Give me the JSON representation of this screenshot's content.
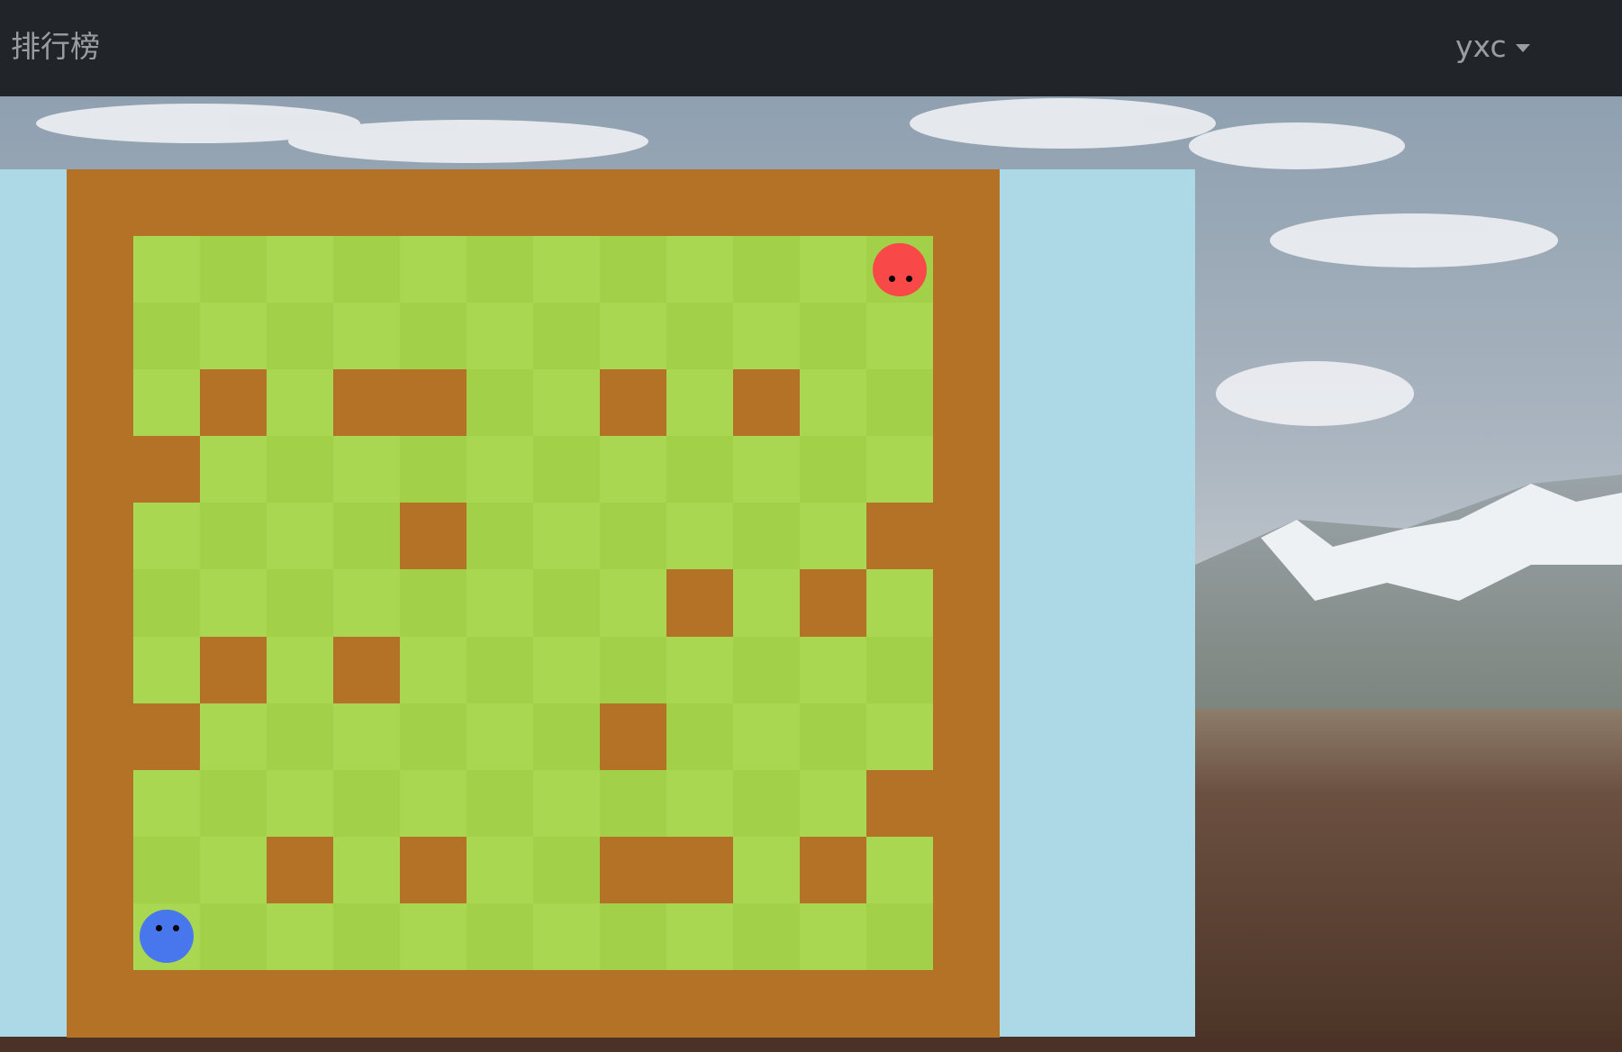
{
  "navbar": {
    "brand": "排行榜",
    "user_menu_label": "yxc"
  },
  "game": {
    "rows": 13,
    "cols": 14,
    "colors": {
      "wall": "#b37226",
      "grass_light": "#aad751",
      "grass_dark": "#a2d149",
      "panel_background": "#add8e6"
    },
    "walls": [
      [
        0,
        0
      ],
      [
        0,
        1
      ],
      [
        0,
        2
      ],
      [
        0,
        3
      ],
      [
        0,
        4
      ],
      [
        0,
        5
      ],
      [
        0,
        6
      ],
      [
        0,
        7
      ],
      [
        0,
        8
      ],
      [
        0,
        9
      ],
      [
        0,
        10
      ],
      [
        0,
        11
      ],
      [
        0,
        12
      ],
      [
        0,
        13
      ],
      [
        1,
        0
      ],
      [
        1,
        13
      ],
      [
        2,
        0
      ],
      [
        2,
        13
      ],
      [
        3,
        0
      ],
      [
        3,
        2
      ],
      [
        3,
        4
      ],
      [
        3,
        5
      ],
      [
        3,
        8
      ],
      [
        3,
        10
      ],
      [
        3,
        13
      ],
      [
        4,
        0
      ],
      [
        4,
        1
      ],
      [
        4,
        13
      ],
      [
        5,
        0
      ],
      [
        5,
        5
      ],
      [
        5,
        12
      ],
      [
        5,
        13
      ],
      [
        6,
        0
      ],
      [
        6,
        9
      ],
      [
        6,
        11
      ],
      [
        6,
        13
      ],
      [
        7,
        0
      ],
      [
        7,
        2
      ],
      [
        7,
        4
      ],
      [
        7,
        13
      ],
      [
        8,
        0
      ],
      [
        8,
        1
      ],
      [
        8,
        8
      ],
      [
        8,
        13
      ],
      [
        9,
        0
      ],
      [
        9,
        12
      ],
      [
        9,
        13
      ],
      [
        10,
        0
      ],
      [
        10,
        3
      ],
      [
        10,
        5
      ],
      [
        10,
        8
      ],
      [
        10,
        9
      ],
      [
        10,
        11
      ],
      [
        10,
        13
      ],
      [
        11,
        0
      ],
      [
        11,
        13
      ],
      [
        12,
        0
      ],
      [
        12,
        1
      ],
      [
        12,
        2
      ],
      [
        12,
        3
      ],
      [
        12,
        4
      ],
      [
        12,
        5
      ],
      [
        12,
        6
      ],
      [
        12,
        7
      ],
      [
        12,
        8
      ],
      [
        12,
        9
      ],
      [
        12,
        10
      ],
      [
        12,
        11
      ],
      [
        12,
        12
      ],
      [
        12,
        13
      ]
    ],
    "snakes": [
      {
        "name": "red-snake",
        "color": "#f94848",
        "row": 1,
        "col": 12,
        "eyes_facing": "down"
      },
      {
        "name": "blue-snake",
        "color": "#4876ec",
        "row": 11,
        "col": 1,
        "eyes_facing": "up"
      }
    ]
  }
}
